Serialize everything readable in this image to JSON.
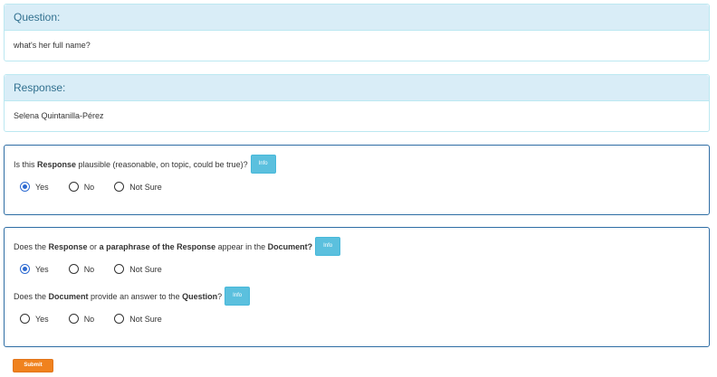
{
  "question": {
    "heading": "Question:",
    "text": "what's her full name?"
  },
  "response": {
    "heading": "Response:",
    "text": "Selena Quintanilla-Pérez"
  },
  "q1": {
    "prefix": "Is this ",
    "bold1": "Response",
    "suffix": " plausible (reasonable, on topic, could be true)?",
    "info_label": "Info",
    "options": [
      "Yes",
      "No",
      "Not Sure"
    ],
    "selected": "Yes"
  },
  "q2": {
    "prefix": "Does the ",
    "bold1": "Response",
    "mid": " or ",
    "bold2": "a paraphrase of the Response",
    "mid2": " appear in the ",
    "bold3": "Document?",
    "info_label": "Info",
    "options": [
      "Yes",
      "No",
      "Not Sure"
    ],
    "selected": "Yes"
  },
  "q3": {
    "prefix": "Does the ",
    "bold1": "Document",
    "mid": " provide an answer to the ",
    "bold2": "Question",
    "suffix": "?",
    "info_label": "Info",
    "options": [
      "Yes",
      "No",
      "Not Sure"
    ],
    "selected": ""
  },
  "submit_label": "Submit"
}
